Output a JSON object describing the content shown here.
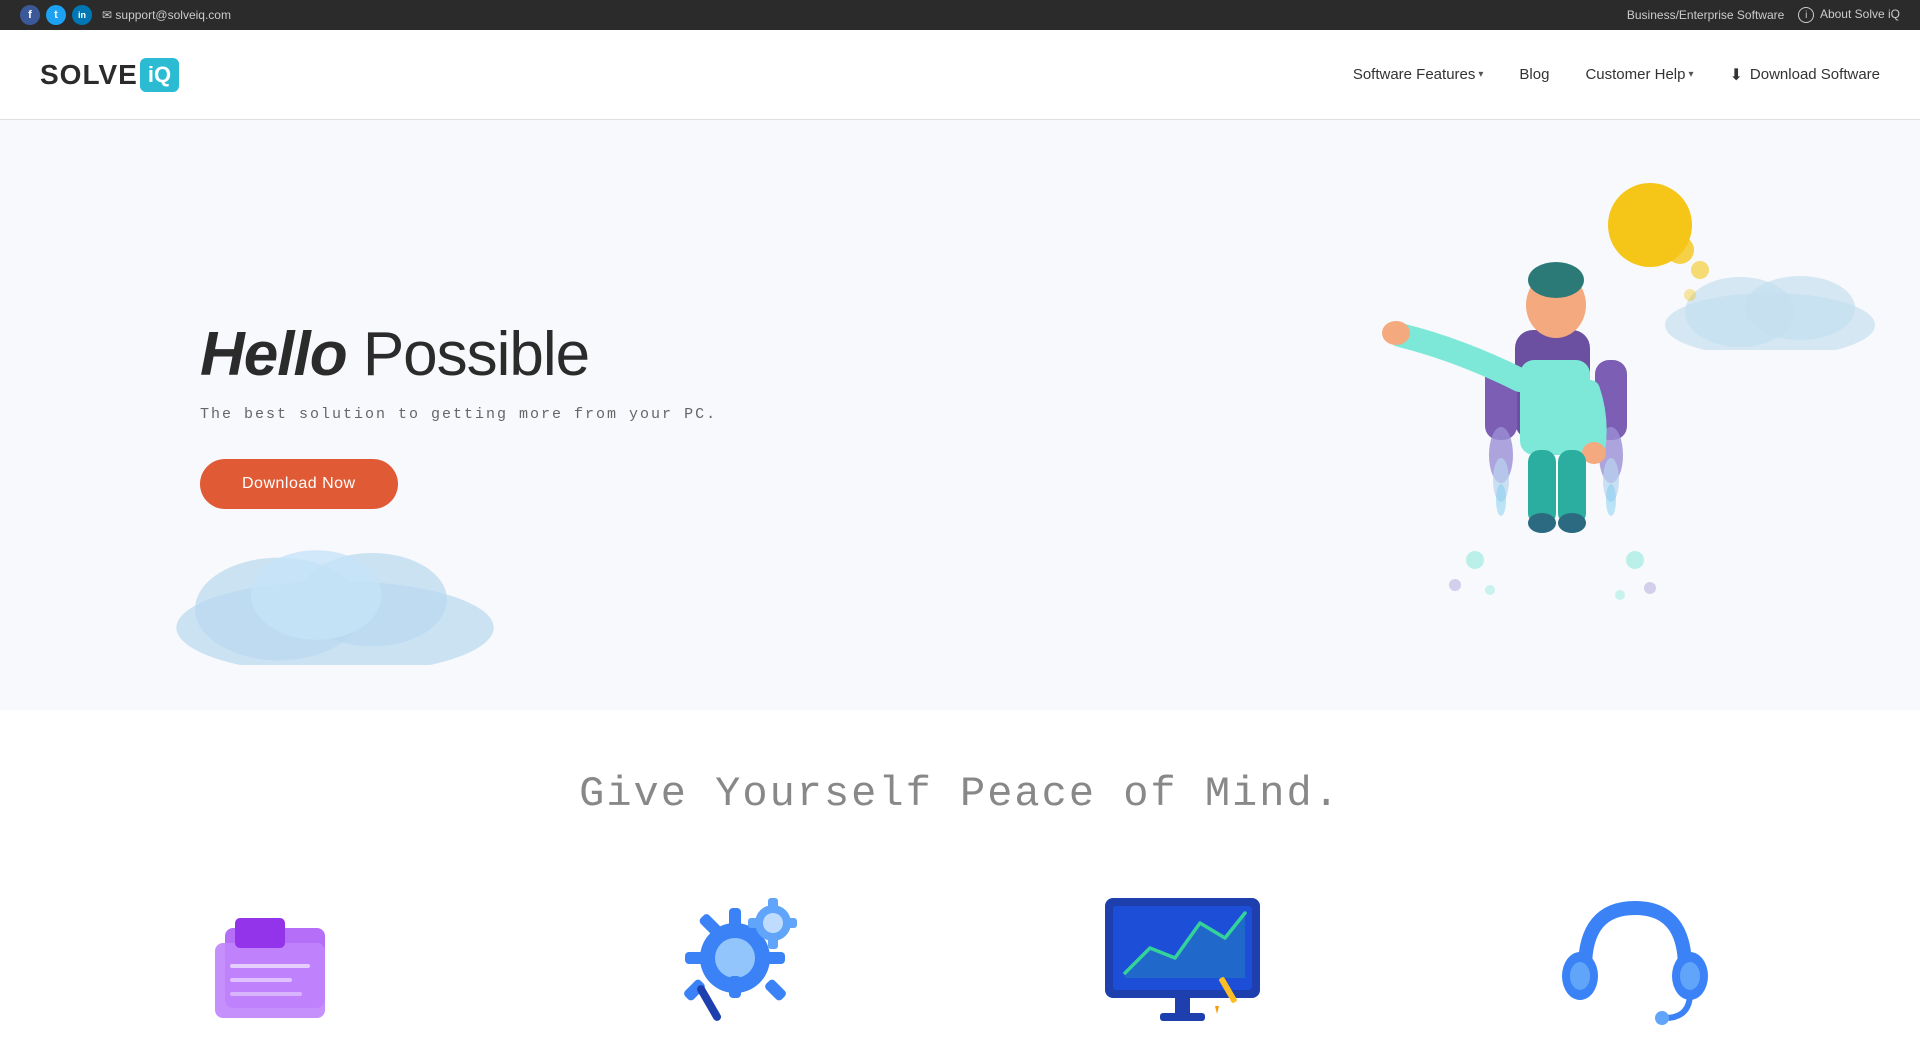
{
  "topbar": {
    "email": "support@solveiq.com",
    "social": [
      {
        "name": "Facebook",
        "letter": "f",
        "class": "fb-icon"
      },
      {
        "name": "Twitter",
        "letter": "t",
        "class": "tw-icon"
      },
      {
        "name": "LinkedIn",
        "letter": "in",
        "class": "li-icon"
      }
    ],
    "enterprise_link": "Business/Enterprise Software",
    "about_label": "About Solve iQ"
  },
  "navbar": {
    "logo_solve": "SOLVE",
    "logo_iq": "iQ",
    "nav_items": [
      {
        "label": "Software Features",
        "has_dropdown": true
      },
      {
        "label": "Blog",
        "has_dropdown": false
      },
      {
        "label": "Customer Help",
        "has_dropdown": true
      }
    ],
    "download_label": "Download Software"
  },
  "hero": {
    "title_bold": "Hello",
    "title_regular": " Possible",
    "subtitle": "The best solution to getting more from your PC.",
    "cta_button": "Download Now"
  },
  "peace": {
    "title": "Give Yourself Peace of Mind."
  },
  "features": [
    {
      "id": "folder",
      "color": "#a855f7"
    },
    {
      "id": "gear",
      "color": "#3b82f6"
    },
    {
      "id": "chart",
      "color": "#2563eb"
    },
    {
      "id": "headset",
      "color": "#3b82f6"
    }
  ]
}
